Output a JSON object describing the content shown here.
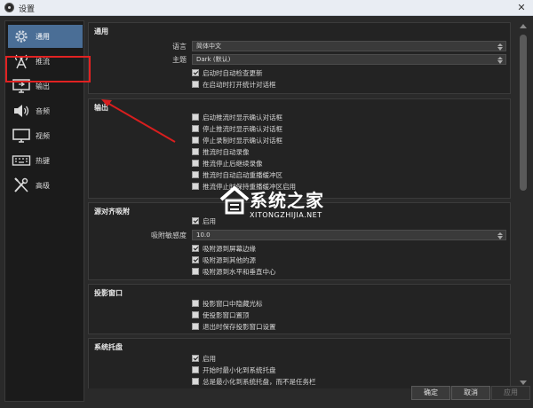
{
  "window": {
    "title": "设置",
    "close_glyph": "✕"
  },
  "sidebar": {
    "items": [
      {
        "label": "通用",
        "icon": "gear-icon"
      },
      {
        "label": "推流",
        "icon": "broadcast-tower-icon"
      },
      {
        "label": "输出",
        "icon": "monitor-output-icon"
      },
      {
        "label": "音频",
        "icon": "speaker-icon"
      },
      {
        "label": "视频",
        "icon": "display-icon"
      },
      {
        "label": "热键",
        "icon": "keyboard-icon"
      },
      {
        "label": "高级",
        "icon": "tools-icon"
      }
    ],
    "active_index": 0,
    "highlighted_index": 2,
    "highlight_color": "#e12222"
  },
  "general": {
    "title": "通用",
    "language_label": "语言",
    "language_value": "简体中文",
    "theme_label": "主题",
    "theme_value": "Dark (默认)",
    "check_updates": {
      "label": "启动时自动检查更新",
      "checked": true
    },
    "open_stats": {
      "label": "在启动时打开统计对话框",
      "checked": false
    }
  },
  "output": {
    "title": "输出",
    "options": [
      {
        "label": "启动推流时显示确认对话框",
        "checked": false
      },
      {
        "label": "停止推流时显示确认对话框",
        "checked": false
      },
      {
        "label": "停止录制时显示确认对话框",
        "checked": false
      },
      {
        "label": "推流时自动录像",
        "checked": false
      },
      {
        "label": "推流停止后继续录像",
        "checked": false
      },
      {
        "label": "推流时自动启动重播缓冲区",
        "checked": false
      },
      {
        "label": "推流停止时保持重播缓冲区启用",
        "checked": false
      }
    ]
  },
  "snapping": {
    "title": "源对齐吸附",
    "enable": {
      "label": "启用",
      "checked": true
    },
    "sensitivity_label": "吸附敏感度",
    "sensitivity_value": "10.0",
    "options": [
      {
        "label": "吸附源到屏幕边缘",
        "checked": true
      },
      {
        "label": "吸附源到其他的源",
        "checked": true
      },
      {
        "label": "吸附源到水平和垂直中心",
        "checked": false
      }
    ]
  },
  "projectors": {
    "title": "投影窗口",
    "options": [
      {
        "label": "投影窗口中隐藏光标",
        "checked": false
      },
      {
        "label": "使投影窗口置顶",
        "checked": false
      },
      {
        "label": "退出时保存投影窗口设置",
        "checked": false
      }
    ]
  },
  "tray": {
    "title": "系统托盘",
    "options": [
      {
        "label": "启用",
        "checked": true
      },
      {
        "label": "开始时最小化到系统托盘",
        "checked": false
      },
      {
        "label": "总是最小化到系统托盘，而不是任务栏",
        "checked": false
      }
    ]
  },
  "buttons": {
    "ok": "确定",
    "cancel": "取消",
    "apply": "应用"
  },
  "watermark": {
    "brand": "系统之家",
    "url": "XITONGZHIJIA.NET"
  },
  "colors": {
    "active_nav": "#4a6e96",
    "annotation": "#d81e1e"
  }
}
